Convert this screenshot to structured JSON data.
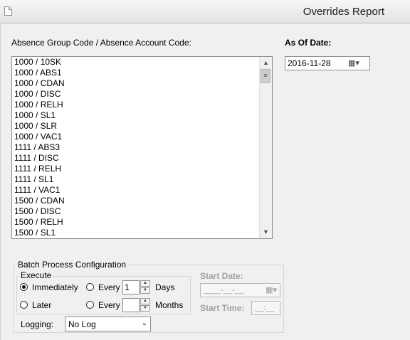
{
  "window": {
    "title": "Overrides Report"
  },
  "absence": {
    "label": "Absence Group Code / Absence Account Code:",
    "items": [
      "1000 / 10SK",
      "1000 / ABS1",
      "1000 / CDAN",
      "1000 / DISC",
      "1000 / RELH",
      "1000 / SL1",
      "1000 / SLR",
      "1000 / VAC1",
      "1111 / ABS3",
      "1111 / DISC",
      "1111 / RELH",
      "1111 / SL1",
      "1111 / VAC1",
      "1500 / CDAN",
      "1500 / DISC",
      "1500 / RELH",
      "1500 / SL1"
    ]
  },
  "as_of": {
    "label": "As Of Date:",
    "value": "2016-11-28"
  },
  "batch": {
    "title": "Batch Process Configuration",
    "execute_label": "Execute",
    "immediately": "Immediately",
    "later": "Later",
    "every": "Every",
    "every_days_value": "1",
    "every_months_value": "",
    "days": "Days",
    "months": "Months",
    "selected": "Immediately",
    "start_date_label": "Start Date:",
    "start_date_value": "____-__-__",
    "start_time_label": "Start Time:",
    "start_time_value": "__:__",
    "logging_label": "Logging:",
    "logging_value": "No Log"
  }
}
